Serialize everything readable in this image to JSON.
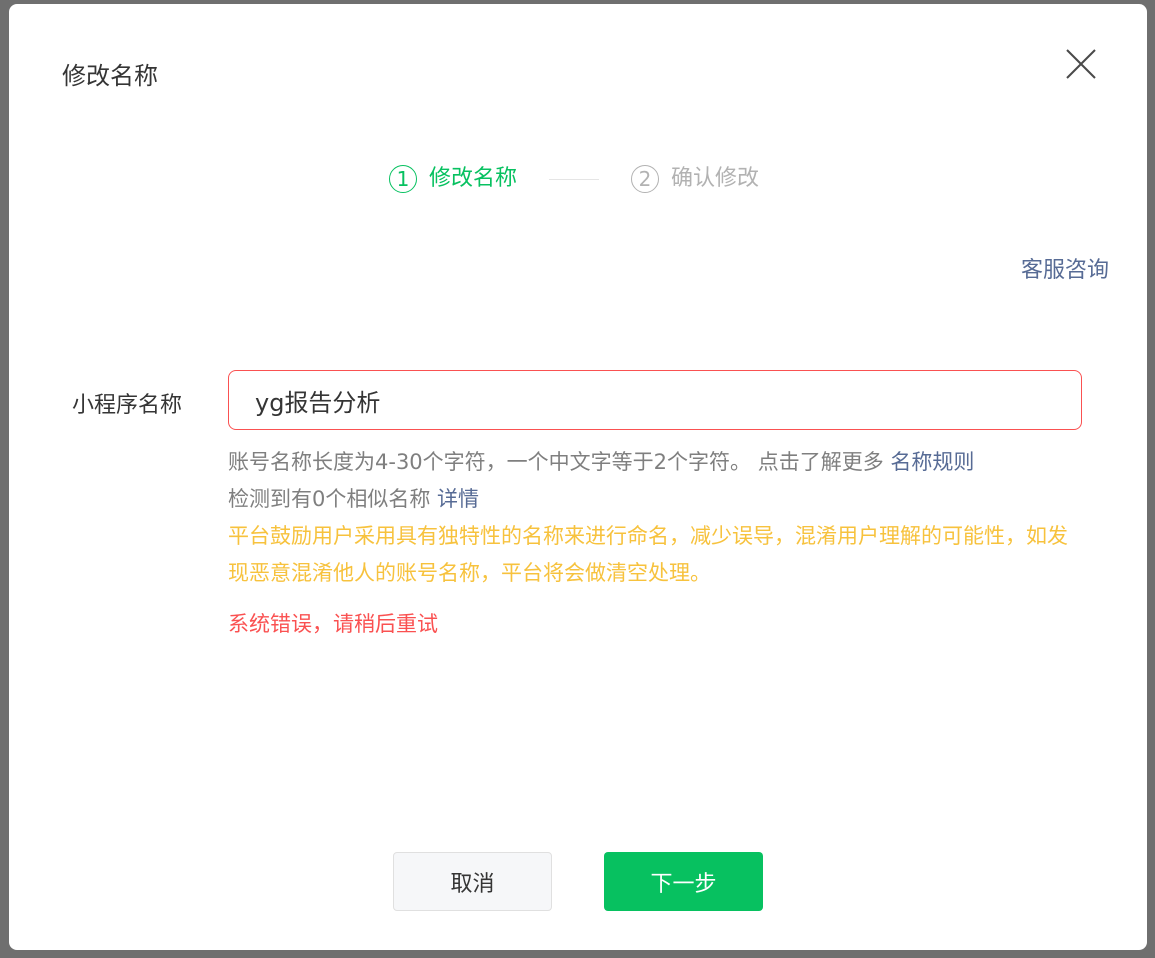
{
  "dialog": {
    "title": "修改名称",
    "close_icon": "close-icon"
  },
  "steps": [
    {
      "number": "1",
      "label": "修改名称",
      "state": "active"
    },
    {
      "number": "2",
      "label": "确认修改",
      "state": "pending"
    }
  ],
  "service_link": "客服咨询",
  "form": {
    "label": "小程序名称",
    "value": "yg报告分析"
  },
  "help": {
    "rule_text": "账号名称长度为4-30个字符，一个中文字等于2个字符。 点击了解更多 ",
    "rule_link": "名称规则",
    "similar_text": "检测到有0个相似名称 ",
    "similar_link": "详情",
    "warning": "平台鼓励用户采用具有独特性的名称来进行命名，减少误导，混淆用户理解的可能性，如发现恶意混淆他人的账号名称，平台将会做清空处理。",
    "error": "系统错误，请稍后重试"
  },
  "buttons": {
    "cancel": "取消",
    "next": "下一步"
  },
  "colors": {
    "accent": "#07c160",
    "link": "#576b95",
    "error": "#fa5151",
    "warning": "#f7c23d",
    "pending": "#b2b2b2"
  }
}
